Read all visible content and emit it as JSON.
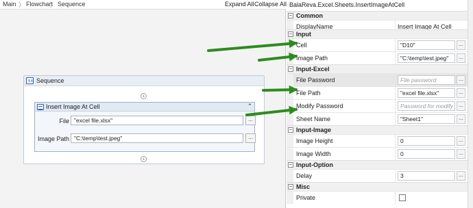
{
  "breadcrumb": {
    "items": [
      "Main",
      "Flowchart",
      "Sequence"
    ],
    "separator": "〉"
  },
  "toolbar": {
    "expand_all": "Expand All",
    "collapse_all": "Collapse All"
  },
  "sequence": {
    "title": "Sequence"
  },
  "activity": {
    "title": "Insert Image At Cell",
    "collapse_glyph": "⌃",
    "fields": [
      {
        "label": "File",
        "value": "\"excel file.xlsx\"",
        "button": "..."
      },
      {
        "label": "Image Path",
        "value": "\"C:\\temp\\test.jpeg\"",
        "button": "..."
      }
    ]
  },
  "properties": {
    "title": "BalaReva.Excel.Sheets.InsertImageAtCell",
    "categories": {
      "common": {
        "label": "Common",
        "toggle": "−"
      },
      "input": {
        "label": "Input",
        "toggle": "−"
      },
      "input_excel": {
        "label": "Input-Excel",
        "toggle": "−"
      },
      "input_image": {
        "label": "Input-Image",
        "toggle": "−"
      },
      "input_option": {
        "label": "Input-Option",
        "toggle": "−"
      },
      "misc": {
        "label": "Misc",
        "toggle": "−"
      }
    },
    "rows": {
      "display_name": {
        "name": "DisplayName",
        "value": "Insert Image At Cell"
      },
      "cell": {
        "name": "Cell",
        "value": "\"D10\"",
        "button": "..."
      },
      "image_path": {
        "name": "Image Path",
        "value": "\"C:\\temp\\test.jpeg\"",
        "button": "..."
      },
      "file_password": {
        "name": "File Password",
        "placeholder": "File password",
        "button": "..."
      },
      "file_path": {
        "name": "File Path",
        "value": "\"excel file.xlsx\"",
        "button": "..."
      },
      "modify_password": {
        "name": "Modify Password",
        "placeholder": "Password for modify",
        "button": "..."
      },
      "sheet_name": {
        "name": "Sheet Name",
        "value": "\"Sheet1\"",
        "button": "..."
      },
      "image_height": {
        "name": "Image Height",
        "value": "0",
        "button": "..."
      },
      "image_width": {
        "name": "Image Width",
        "value": "0",
        "button": "..."
      },
      "delay": {
        "name": "Delay",
        "value": "3",
        "button": "..."
      },
      "private": {
        "name": "Private",
        "checked": false
      }
    }
  },
  "colors": {
    "arrow": "#2e8b1f",
    "accent": "#2e5ea3"
  },
  "plus_glyph": "+"
}
